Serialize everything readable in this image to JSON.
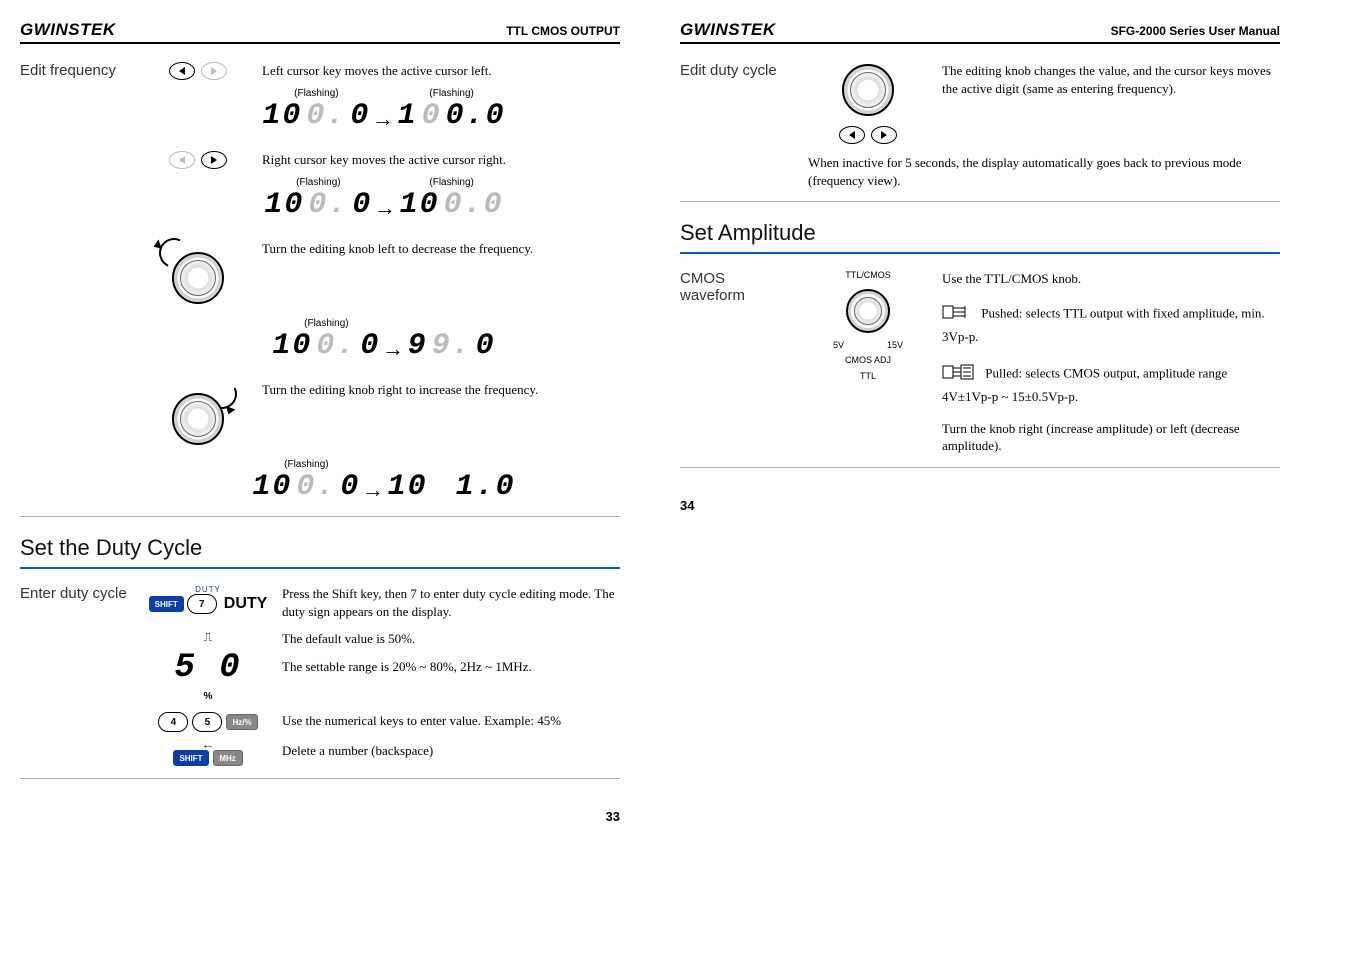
{
  "brand": "GWINSTEK",
  "left": {
    "header_title": "TTL CMOS OUTPUT",
    "page_num": "33",
    "edit_freq": {
      "label": "Edit frequency",
      "r1": "Left cursor key moves the active cursor left.",
      "r2": "Right cursor key moves the active cursor right.",
      "r3": "Turn the editing knob left to decrease the frequency.",
      "r4": "Turn the editing knob right to increase the frequency.",
      "flash": "(Flashing)",
      "seg1a": "10",
      "seg1a_dim": "0.",
      "seg1a2": "0",
      "seg1b": "1",
      "seg1b_dim": "0",
      "seg1b2": "0.0",
      "seg2a": "10",
      "seg2a_dim": "0.",
      "seg2a2": "0",
      "seg2b": "10",
      "seg2b_dim": "0.0",
      "seg3a": "10",
      "seg3a_dim": "0.",
      "seg3a2": "0",
      "seg3b": "9",
      "seg3b_dim": "9.",
      "seg3b2": "0",
      "seg4a": "10",
      "seg4a_dim": "0.",
      "seg4a2": "0",
      "seg4b": "10",
      "seg4b2": "1.0"
    },
    "duty_heading": "Set the Duty Cycle",
    "enter_duty": {
      "label": "Enter duty cycle",
      "duty_top": "DUTY",
      "duty_text": "DUTY",
      "shift": "SHIFT",
      "seven": "7",
      "r1": "Press the Shift key, then 7 to enter duty cycle editing mode. The duty sign appears on the display.",
      "seg_val": "5 0",
      "pct": "%",
      "r2": "The default value is 50%.",
      "r3": "The settable range is 20% ~ 80%, 2Hz ~ 1MHz.",
      "k4": "4",
      "k5": "5",
      "hzpct": "Hz/%",
      "r4": "Use the numerical keys to enter value. Example: 45%",
      "mhz": "MHz",
      "r5": "Delete a number (backspace)"
    }
  },
  "right": {
    "header_title": "SFG-2000 Series User Manual",
    "page_num": "34",
    "edit_duty": {
      "label": "Edit duty cycle",
      "r1": "The editing knob changes the value, and the cursor keys moves the active digit (same as entering frequency).",
      "r2": "When inactive for 5 seconds, the display automatically goes back to previous mode (frequency view)."
    },
    "amp_heading": "Set Amplitude",
    "cmos": {
      "label": "CMOS waveform",
      "knob_top": "TTL/CMOS",
      "knob_5v": "5V",
      "knob_15v": "15V",
      "knob_adj": "CMOS ADJ",
      "knob_ttl": "TTL",
      "r1": "Use the TTL/CMOS knob.",
      "r2a": "Pushed: selects TTL output with fixed amplitude, min. 3Vp-p.",
      "r3a": "Pulled: selects CMOS output, amplitude range 4V±1Vp-p ~ 15±0.5Vp-p.",
      "r4": "Turn the knob right (increase amplitude) or left (decrease amplitude)."
    }
  }
}
